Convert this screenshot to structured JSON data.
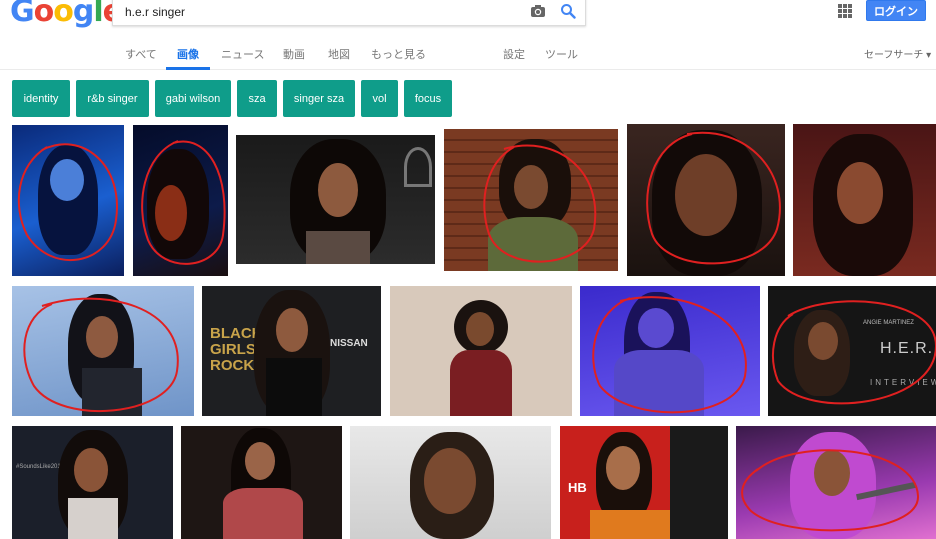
{
  "header": {
    "logo_letters": [
      "G",
      "o",
      "o",
      "g",
      "l",
      "e"
    ],
    "search_query": "h.e.r singer",
    "login_label": "ログイン",
    "icons": {
      "camera": "camera-icon",
      "search": "search-icon",
      "apps": "apps-grid-icon"
    }
  },
  "tabs": {
    "items": [
      "すべて",
      "画像",
      "ニュース",
      "動画",
      "地図",
      "もっと見る",
      "設定",
      "ツール"
    ],
    "active": "画像",
    "safe_search": "セーフサーチ ▾"
  },
  "chips": [
    "identity",
    "r&b singer",
    "gabi wilson",
    "sza",
    "singer sza",
    "vol",
    "focus"
  ],
  "images": {
    "overlay_texts": {
      "essence": "BLACK GIRLS ROCK",
      "nissan": "NISSAN",
      "angie": "ANGIE MARTINEZ",
      "her": "H.E.R.",
      "interview": "INTERVIEW",
      "sounds": "#SoundsLike2017",
      "logo_hb": "HB"
    }
  },
  "colors": {
    "accent_blue": "#4285f4",
    "chip_teal": "#0f9d8a",
    "red_annotation": "#e02020"
  }
}
